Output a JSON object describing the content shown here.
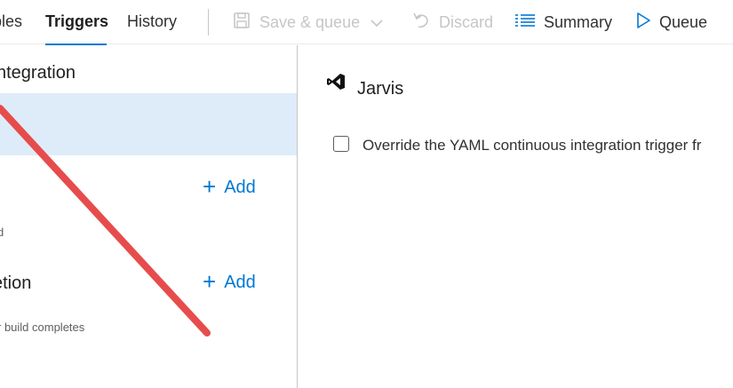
{
  "toolbar": {
    "tabs": [
      {
        "label": "bles"
      },
      {
        "label": "Triggers"
      },
      {
        "label": "History"
      }
    ],
    "save_queue_label": "Save & queue",
    "discard_label": "Discard",
    "summary_label": "Summary",
    "queue_label": "Queue"
  },
  "left_pane": {
    "ci_title": "ntegration",
    "add_label_1": "Add",
    "small_text_1": "d",
    "build_completion_title": "etion",
    "add_label_2": "Add",
    "small_text_2": "r build completes"
  },
  "right_pane": {
    "repo_name": "Jarvis",
    "override_label": "Override the YAML continuous integration trigger fr"
  },
  "colors": {
    "accent": "#0078d4",
    "selected_bg": "#deecf9",
    "annotation_arrow": "#e74c4c",
    "disabled_text": "#c8c6c4"
  }
}
